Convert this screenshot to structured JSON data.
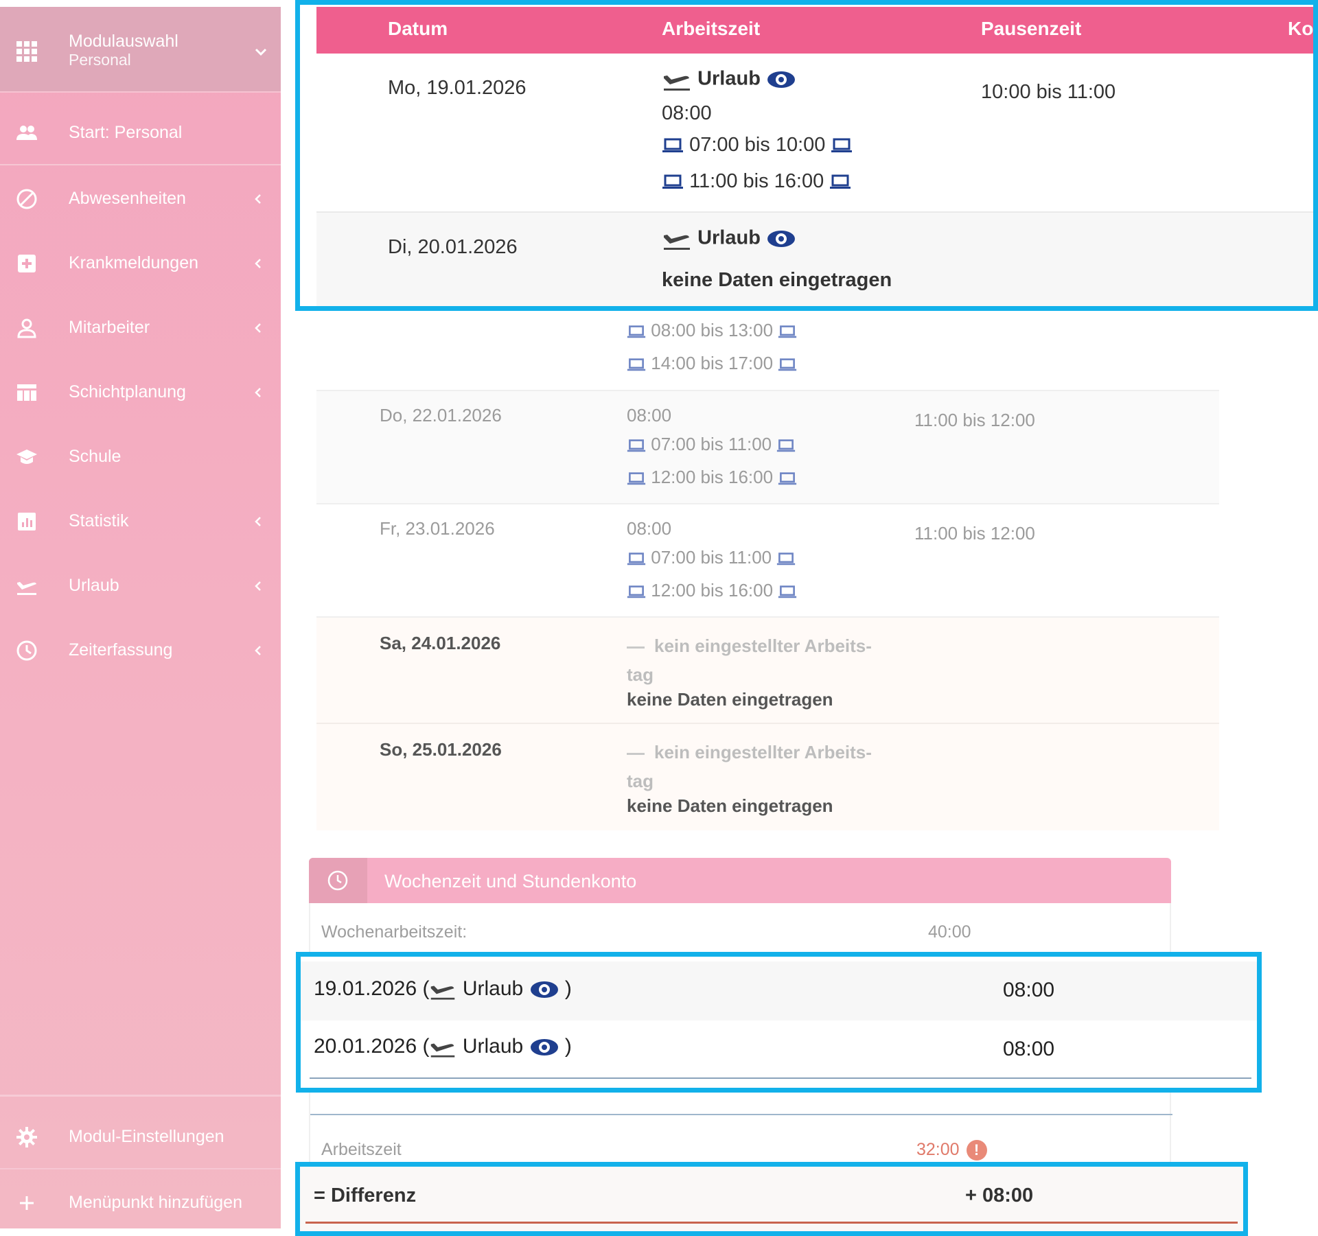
{
  "sidebar": {
    "module": {
      "title": "Modulauswahl",
      "subtitle": "Personal"
    },
    "items": [
      {
        "label": "Start: Personal",
        "icon": "people-icon",
        "chevron": false
      },
      {
        "label": "Abwesenheiten",
        "icon": "block-icon",
        "chevron": true
      },
      {
        "label": "Krankmeldungen",
        "icon": "medical-plus-icon",
        "chevron": true
      },
      {
        "label": "Mitarbeiter",
        "icon": "person-icon",
        "chevron": true
      },
      {
        "label": "Schichtplanung",
        "icon": "calendar-grid-icon",
        "chevron": true
      },
      {
        "label": "Schule",
        "icon": "graduation-cap-icon",
        "chevron": false
      },
      {
        "label": "Statistik",
        "icon": "bar-chart-icon",
        "chevron": true
      },
      {
        "label": "Urlaub",
        "icon": "airplane-icon",
        "chevron": true
      },
      {
        "label": "Zeiterfassung",
        "icon": "clock-icon",
        "chevron": true
      }
    ],
    "bottom": [
      {
        "label": "Modul-Einstellungen",
        "icon": "gear-icon"
      },
      {
        "label": "Menüpunkt hinzufügen",
        "icon": "plus-icon"
      }
    ]
  },
  "table": {
    "headers": [
      "Datum",
      "Arbeitszeit",
      "Pausenzeit",
      "Ko"
    ],
    "rows": [
      {
        "date": "Mo, 19.01.2026",
        "absence": "Urlaub",
        "hours": "08:00",
        "slots": [
          "07:00 bis 10:00",
          "11:00 bis 16:00"
        ],
        "pause": "10:00 bis 11:00"
      },
      {
        "date": "Di, 20.01.2026",
        "absence": "Urlaub",
        "note": "keine Daten eingetragen"
      },
      {
        "slots": [
          "08:00 bis 13:00",
          "14:00 bis 17:00"
        ]
      },
      {
        "date": "Do, 22.01.2026",
        "hours": "08:00",
        "slots": [
          "07:00 bis 11:00",
          "12:00 bis 16:00"
        ],
        "pause": "11:00 bis 12:00"
      },
      {
        "date": "Fr, 23.01.2026",
        "hours": "08:00",
        "slots": [
          "07:00 bis 11:00",
          "12:00 bis 16:00"
        ],
        "pause": "11:00 bis 12:00"
      },
      {
        "date": "Sa, 24.01.2026",
        "nonday_line1": "kein eingestellter Arbeits-",
        "nonday_line2": "tag",
        "note": "keine Daten eingetragen"
      },
      {
        "date": "So, 25.01.2026",
        "nonday_line1": "kein eingestellter Arbeits-",
        "nonday_line2": "tag",
        "note": "keine Daten eingetragen"
      }
    ]
  },
  "summary": {
    "title": "Wochenzeit und Stundenkonto",
    "weekly_label": "Wochenarbeitszeit:",
    "weekly_value": "40:00",
    "vacation_rows": [
      {
        "date": "19.01.2026",
        "label": "Urlaub",
        "value": "08:00"
      },
      {
        "date": "20.01.2026",
        "label": "Urlaub",
        "value": "08:00"
      }
    ],
    "work_label": "Arbeitszeit",
    "work_value": "32:00",
    "diff_label": "= Differenz",
    "diff_value": "+ 08:00"
  },
  "colors": {
    "header_pink": "#ef5f8e",
    "sidebar_pink": "#f3a6be",
    "highlight_blue": "#12b1ea",
    "icon_blue": "#1f3f8f",
    "warning": "#e98a78"
  }
}
